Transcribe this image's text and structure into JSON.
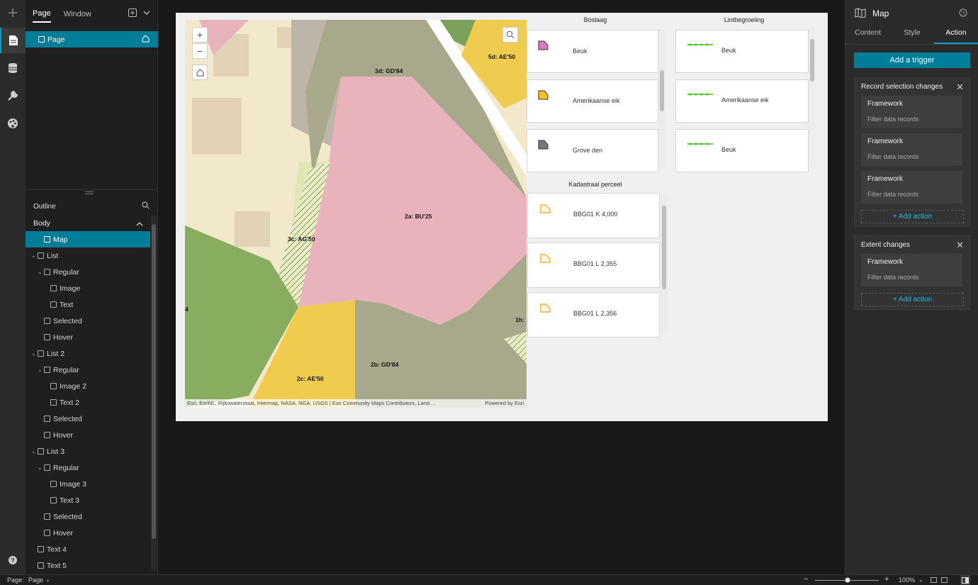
{
  "left_toolbar": {
    "items": [
      "plus-icon",
      "page-icon",
      "data-icon",
      "tools-icon",
      "theme-icon"
    ],
    "help": "help-icon"
  },
  "page_panel": {
    "tabs": [
      "Page",
      "Window"
    ],
    "page_item": "Page"
  },
  "outline": {
    "title": "Outline",
    "body": "Body",
    "items": [
      {
        "label": "Map",
        "level": 1,
        "selected": true
      },
      {
        "label": "List",
        "level": 0
      },
      {
        "label": "Regular",
        "level": 1
      },
      {
        "label": "Image",
        "level": 2
      },
      {
        "label": "Text",
        "level": 2
      },
      {
        "label": "Selected",
        "level": 1
      },
      {
        "label": "Hover",
        "level": 1
      },
      {
        "label": "List 2",
        "level": 0
      },
      {
        "label": "Regular",
        "level": 1
      },
      {
        "label": "Image 2",
        "level": 2
      },
      {
        "label": "Text 2",
        "level": 2
      },
      {
        "label": "Selected",
        "level": 1
      },
      {
        "label": "Hover",
        "level": 1
      },
      {
        "label": "List 3",
        "level": 0
      },
      {
        "label": "Regular",
        "level": 1
      },
      {
        "label": "Image 3",
        "level": 2
      },
      {
        "label": "Text 3",
        "level": 2
      },
      {
        "label": "Selected",
        "level": 1
      },
      {
        "label": "Hover",
        "level": 1
      },
      {
        "label": "Text 4",
        "level": 0
      },
      {
        "label": "Text 5",
        "level": 0
      }
    ]
  },
  "map": {
    "labels": [
      "3d: GD'84",
      "5d: AE'50",
      "2a: BU'25",
      "3c: AG'50",
      "2c: AE'50",
      "2b: GD'84",
      "1h:",
      "4"
    ],
    "attribution": "Esri, EsriNL, Rijkswaterstaat, Intermap, NASA, NGA, USGS | Esri Community Maps Contributors, Land ...",
    "powered": "Powered by Esri"
  },
  "list1": {
    "title": "Boslaag",
    "items": [
      "Beuk",
      "Amerikaanse eik",
      "Grove den"
    ],
    "colors": [
      "#d97bb8",
      "#f2c21d",
      "#777777"
    ]
  },
  "list2": {
    "title": "Lintbegroeiing",
    "items": [
      "Beuk",
      "Amerikaanse eik",
      "Beuk"
    ]
  },
  "list3": {
    "title": "Kadastraal perceel",
    "items": [
      "BBG01 K 4,000",
      "BBG01 L 2,355",
      "BBG01 L 2,356"
    ]
  },
  "right_panel": {
    "title": "Map",
    "tabs": [
      "Content",
      "Style",
      "Action"
    ],
    "add_trigger": "Add a trigger",
    "groups": [
      {
        "title": "Record selection changes",
        "actions": [
          {
            "title": "Framework",
            "sub": "Filter data records"
          },
          {
            "title": "Framework",
            "sub": "Filter data records"
          },
          {
            "title": "Framework",
            "sub": "Filter data records"
          }
        ],
        "add": "+ Add action"
      },
      {
        "title": "Extent changes",
        "actions": [
          {
            "title": "Framework",
            "sub": "Filter data records"
          }
        ],
        "add": "+ Add action"
      }
    ]
  },
  "status": {
    "page_label": "Page:",
    "page_value": "Page",
    "zoom": "100%"
  }
}
